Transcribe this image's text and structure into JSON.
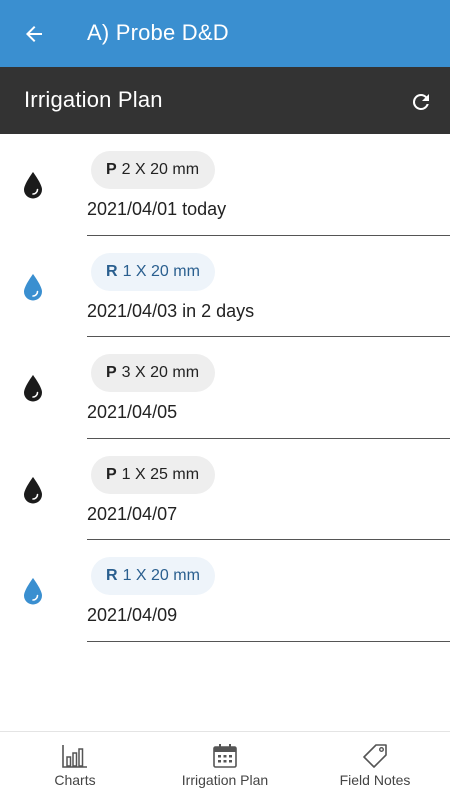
{
  "app_bar": {
    "title": "A) Probe D&D"
  },
  "sub_header": {
    "title": "Irrigation Plan"
  },
  "plan": [
    {
      "kind": "P",
      "detail": "2 X 20 mm",
      "date_text": "2021/04/01 today",
      "drop_color": "#1b1b1b"
    },
    {
      "kind": "R",
      "detail": "1 X 20 mm",
      "date_text": "2021/04/03 in 2 days",
      "drop_color": "#3a8fd0"
    },
    {
      "kind": "P",
      "detail": "3 X 20 mm",
      "date_text": "2021/04/05",
      "drop_color": "#1b1b1b"
    },
    {
      "kind": "P",
      "detail": "1 X 25 mm",
      "date_text": "2021/04/07",
      "drop_color": "#1b1b1b"
    },
    {
      "kind": "R",
      "detail": "1 X 20 mm",
      "date_text": "2021/04/09",
      "drop_color": "#3a8fd0"
    }
  ],
  "bottom_nav": [
    {
      "label": "Charts",
      "icon": "bar-chart-icon"
    },
    {
      "label": "Irrigation Plan",
      "icon": "calendar-icon"
    },
    {
      "label": "Field Notes",
      "icon": "tag-icon"
    }
  ],
  "colors": {
    "primary": "#3a8fd0",
    "toolbar": "#333333"
  }
}
